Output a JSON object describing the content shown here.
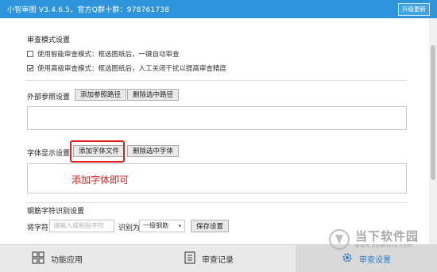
{
  "app": {
    "title": "小智审图 V3.4.6.5，官方Q群十群：978761738",
    "upgrade_label": "升级更新"
  },
  "review_mode": {
    "title": "审查模式设置",
    "options": [
      {
        "label": "使用智能审查模式：框选图纸后，一键自动审查",
        "checked": false
      },
      {
        "label": "使用高级审查模式：框选图纸后，人工关闭干扰以提高审查精度",
        "checked": true
      }
    ]
  },
  "external_ref": {
    "title": "外部参照设置",
    "add_label": "添加参照路径",
    "delete_label": "删除选中路径"
  },
  "font_display": {
    "title": "字体显示设置",
    "add_label": "添加字体文件",
    "delete_label": "删除选中字体"
  },
  "annotation": "添加字体即可",
  "rebar": {
    "title": "钢筋字符识别设置",
    "char_label": "将字符",
    "input_placeholder": "请输入或粘贴字符",
    "recognize_as": "识别为",
    "selected_grade": "一级钢筋",
    "save_label": "保存设置"
  },
  "bottom_nav": [
    {
      "label": "功能应用",
      "icon": "grid-icon",
      "active": false
    },
    {
      "label": "审查记录",
      "icon": "list-icon",
      "active": false
    },
    {
      "label": "审查设置",
      "icon": "settings-icon",
      "active": true
    }
  ],
  "watermark": {
    "text": "当下软件园",
    "sub": "www.downxia.com"
  },
  "colors": {
    "titlebar": "#2e95dc",
    "annotation": "#e01e1e",
    "active_nav": "#2e7fc8"
  }
}
